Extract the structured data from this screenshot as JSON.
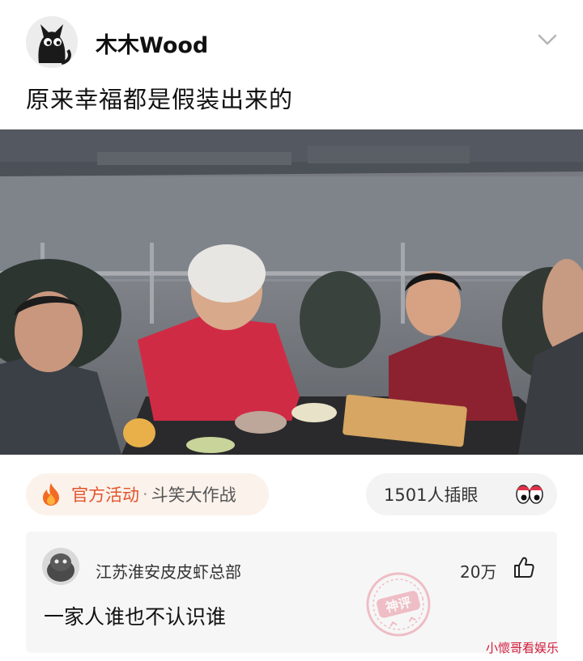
{
  "post": {
    "author": "木木Wood",
    "title": "原来幸福都是假装出来的"
  },
  "media": {
    "icon": "photo-dinner-scene"
  },
  "activity": {
    "label": "官方活动",
    "separator": "·",
    "name": "斗笑大作战",
    "icon": "fire-icon",
    "color": "#e2542c"
  },
  "eyes": {
    "text": "1501人插眼",
    "icon": "eyes-icon"
  },
  "comment": {
    "user": "江苏淮安皮皮虾总部",
    "likes": "20万",
    "text": "一家人谁也不认识谁",
    "stamp": "神评"
  },
  "watermark": "小懷哥看娱乐"
}
